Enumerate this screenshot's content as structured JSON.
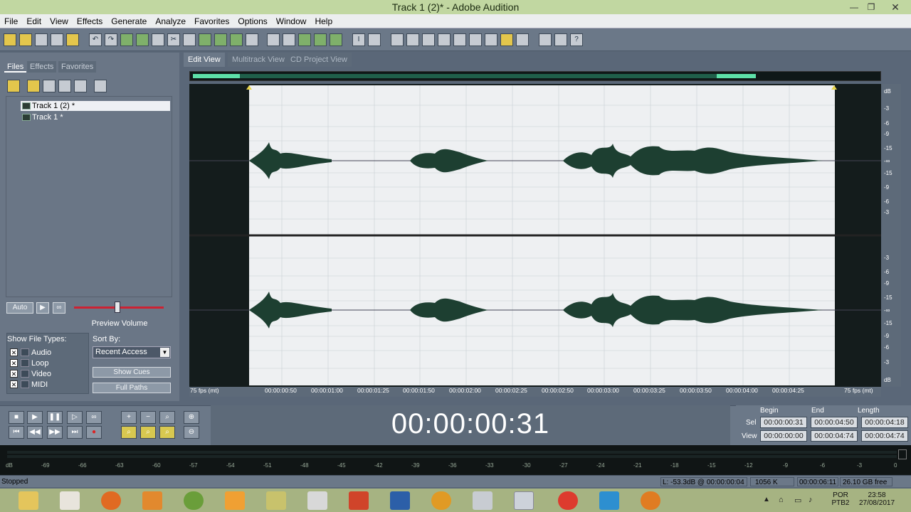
{
  "window": {
    "title": "Track 1 (2)* - Adobe Audition"
  },
  "menu": [
    "File",
    "Edit",
    "View",
    "Effects",
    "Generate",
    "Analyze",
    "Favorites",
    "Options",
    "Window",
    "Help"
  ],
  "left_panel": {
    "tabs": [
      "Files",
      "Effects",
      "Favorites"
    ],
    "files": [
      "Track 1 (2) *",
      "Track 1 *"
    ],
    "auto_label": "Auto",
    "preview_volume": "Preview Volume",
    "show_types_label": "Show File Types:",
    "file_types": [
      "Audio",
      "Loop",
      "Video",
      "MIDI"
    ],
    "sort_label": "Sort By:",
    "sort_value": "Recent Access",
    "show_cues": "Show Cues",
    "full_paths": "Full Paths"
  },
  "view_tabs": [
    "Edit View",
    "Multitrack View",
    "CD Project View"
  ],
  "db_scale": [
    "dB",
    "-3",
    "-6",
    "-9",
    "-15",
    "-∞",
    "-15",
    "-9",
    "-6",
    "-3"
  ],
  "db_scale_bottom": [
    "-3",
    "-6",
    "-9",
    "-15",
    "-∞",
    "-15",
    "-9",
    "-6",
    "-3",
    "dB"
  ],
  "timeline": {
    "left": "75 fps (mt)",
    "right": "75 fps (mt)",
    "ticks": [
      "00:00:00:50",
      "00:00:01:00",
      "00:00:01:25",
      "00:00:01:50",
      "00:00:02:00",
      "00:00:02:25",
      "00:00:02:50",
      "00:00:03:00",
      "00:00:03:25",
      "00:00:03:50",
      "00:00:04:00",
      "00:00:04:25"
    ]
  },
  "time_display": "00:00:00:31",
  "selection": {
    "headers": [
      "Begin",
      "End",
      "Length"
    ],
    "sel_label": "Sel",
    "view_label": "View",
    "sel": [
      "00:00:00:31",
      "00:00:04:50",
      "00:00:04:18"
    ],
    "view": [
      "00:00:00:00",
      "00:00:04:74",
      "00:00:04:74"
    ]
  },
  "meter_labels": [
    "dB",
    "-69",
    "-66",
    "-63",
    "-60",
    "-57",
    "-54",
    "-51",
    "-48",
    "-45",
    "-42",
    "-39",
    "-36",
    "-33",
    "-30",
    "-27",
    "-24",
    "-21",
    "-18",
    "-15",
    "-12",
    "-9",
    "-6",
    "-3",
    "0"
  ],
  "status": {
    "state": "Stopped",
    "level": "L: -53.3dB @ 00:00:00:04",
    "size": "1056 K",
    "duration": "00:00:06:11",
    "free": "26.10 GB free"
  },
  "taskbar": {
    "lang": "POR",
    "layout": "PTB2",
    "time": "23:58",
    "date": "27/08/2017"
  }
}
